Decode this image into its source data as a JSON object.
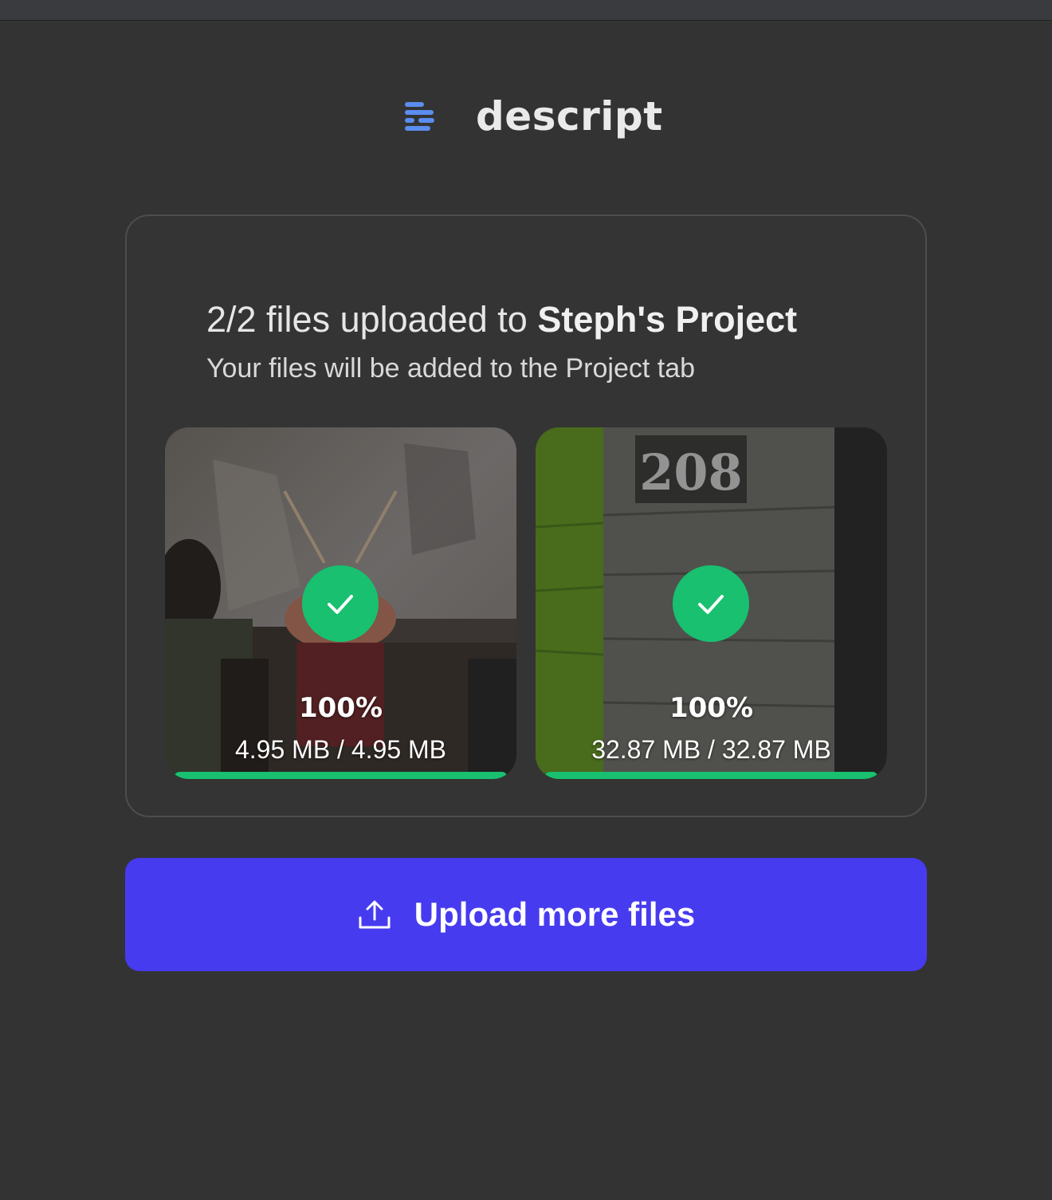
{
  "brand": {
    "name": "descript",
    "logo_icon": "descript-logo-icon",
    "accent_color": "#5b8def"
  },
  "upload": {
    "headline_prefix": "2/2 files uploaded to",
    "project_name": "Steph's Project",
    "subline": "Your files will be added to the Project tab",
    "files": [
      {
        "percent_label": "100%",
        "size_label": "4.95 MB / 4.95 MB",
        "progress": 1.0,
        "status_icon": "check-icon"
      },
      {
        "percent_label": "100%",
        "size_label": "32.87 MB / 32.87 MB",
        "progress": 1.0,
        "status_icon": "check-icon"
      }
    ],
    "status_color": "#18c06f"
  },
  "actions": {
    "upload_more_label": "Upload more files",
    "upload_icon": "upload-icon",
    "button_color": "#473bf0"
  }
}
